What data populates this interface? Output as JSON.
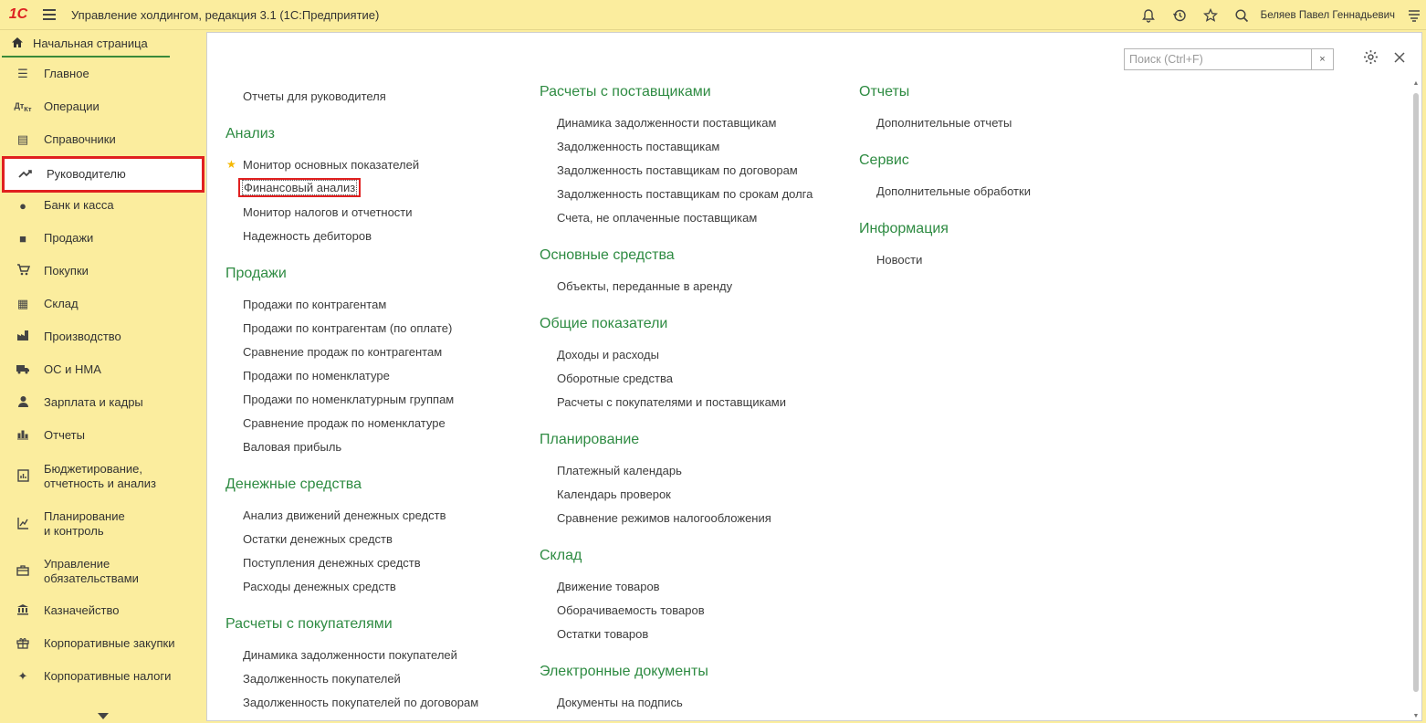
{
  "titlebar": {
    "logo": "1С",
    "title": "Управление холдингом, редакция 3.1  (1С:Предприятие)",
    "user": "Беляев Павел Геннадьевич",
    "icons": [
      "bell-icon",
      "history-icon",
      "star-icon",
      "search-icon",
      "menu-lines-icon"
    ]
  },
  "home_tab": {
    "label": "Начальная страница",
    "icon": "home-icon"
  },
  "sidebar": {
    "items": [
      {
        "label": "Главное",
        "icon": "menu-lines-icon"
      },
      {
        "label": "Операции",
        "icon": "dt-kt-icon"
      },
      {
        "label": "Справочники",
        "icon": "books-icon"
      },
      {
        "label": "Руководителю",
        "icon": "trend-icon",
        "active": true
      },
      {
        "label": "Банк и касса",
        "icon": "coin-icon"
      },
      {
        "label": "Продажи",
        "icon": "bag-icon"
      },
      {
        "label": "Покупки",
        "icon": "cart-icon"
      },
      {
        "label": "Склад",
        "icon": "warehouse-icon"
      },
      {
        "label": "Производство",
        "icon": "factory-icon"
      },
      {
        "label": "ОС и НМА",
        "icon": "truck-icon"
      },
      {
        "label": "Зарплата и кадры",
        "icon": "person-icon"
      },
      {
        "label": "Отчеты",
        "icon": "bar-chart-icon"
      },
      {
        "label": "Бюджетирование,\nотчетность и анализ",
        "icon": "report-icon"
      },
      {
        "label": "Планирование\nи контроль",
        "icon": "planning-icon"
      },
      {
        "label": "Управление\nобязательствами",
        "icon": "briefcase-icon"
      },
      {
        "label": "Казначейство",
        "icon": "bank-icon"
      },
      {
        "label": "Корпоративные закупки",
        "icon": "gift-icon"
      },
      {
        "label": "Корпоративные налоги",
        "icon": "emblem-icon"
      }
    ]
  },
  "search": {
    "placeholder": "Поиск (Ctrl+F)",
    "clear": "×"
  },
  "content": {
    "col1": {
      "top_link": "Отчеты для руководителя",
      "sections": [
        {
          "title": "Анализ",
          "links": [
            "Монитор основных показателей",
            "Финансовый анализ",
            "Монитор налогов и отчетности",
            "Надежность дебиторов"
          ]
        },
        {
          "title": "Продажи",
          "links": [
            "Продажи по контрагентам",
            "Продажи по контрагентам (по оплате)",
            "Сравнение продаж по контрагентам",
            "Продажи по номенклатуре",
            "Продажи по номенклатурным группам",
            "Сравнение продаж по номенклатуре",
            "Валовая прибыль"
          ]
        },
        {
          "title": "Денежные средства",
          "links": [
            "Анализ движений денежных средств",
            "Остатки денежных средств",
            "Поступления денежных средств",
            "Расходы денежных средств"
          ]
        },
        {
          "title": "Расчеты с покупателями",
          "links": [
            "Динамика задолженности покупателей",
            "Задолженность покупателей",
            "Задолженность покупателей по договорам"
          ]
        }
      ]
    },
    "col2": {
      "sections": [
        {
          "title": "Расчеты с поставщиками",
          "links": [
            "Динамика задолженности поставщикам",
            "Задолженность поставщикам",
            "Задолженность поставщикам по договорам",
            "Задолженность поставщикам по срокам долга",
            "Счета, не оплаченные поставщикам"
          ]
        },
        {
          "title": "Основные средства",
          "links": [
            "Объекты, переданные в аренду"
          ]
        },
        {
          "title": "Общие показатели",
          "links": [
            "Доходы и расходы",
            "Оборотные средства",
            "Расчеты с покупателями и поставщиками"
          ]
        },
        {
          "title": "Планирование",
          "links": [
            "Платежный календарь",
            "Календарь проверок",
            "Сравнение режимов налогообложения"
          ]
        },
        {
          "title": "Склад",
          "links": [
            "Движение товаров",
            "Оборачиваемость товаров",
            "Остатки товаров"
          ]
        },
        {
          "title": "Электронные документы",
          "links": [
            "Документы на подпись"
          ]
        }
      ]
    },
    "col3": {
      "sections": [
        {
          "title": "Отчеты",
          "links": [
            "Дополнительные отчеты"
          ]
        },
        {
          "title": "Сервис",
          "links": [
            "Дополнительные обработки"
          ]
        },
        {
          "title": "Информация",
          "links": [
            "Новости"
          ]
        }
      ]
    }
  }
}
